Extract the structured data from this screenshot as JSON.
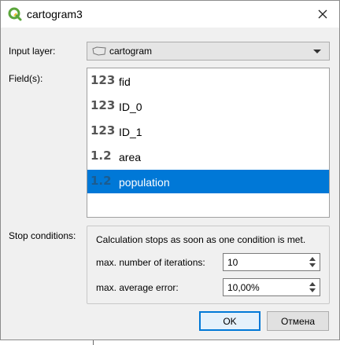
{
  "window": {
    "title": "cartogram3",
    "app_icon": "qgis-icon",
    "close_icon": "close-icon"
  },
  "input_layer": {
    "label": "Input layer:",
    "value": "cartogram",
    "icon": "polygon-layer-icon"
  },
  "fields": {
    "label": "Field(s):",
    "items": [
      {
        "type": "123",
        "name": "fid",
        "selected": false
      },
      {
        "type": "123",
        "name": "ID_0",
        "selected": false
      },
      {
        "type": "123",
        "name": "ID_1",
        "selected": false
      },
      {
        "type": "1.2",
        "name": "area",
        "selected": false
      },
      {
        "type": "1.2",
        "name": "population",
        "selected": true
      }
    ]
  },
  "stop_conditions": {
    "label": "Stop conditions:",
    "message": "Calculation stops as soon as one condition is met.",
    "max_iterations": {
      "label": "max. number of iterations:",
      "value": "10"
    },
    "max_error": {
      "label": "max. average error:",
      "value": "10,00%"
    }
  },
  "buttons": {
    "ok": "OK",
    "cancel": "Отмена"
  },
  "colors": {
    "selection": "#0078d7",
    "qgis_green": "#5ba63b"
  }
}
